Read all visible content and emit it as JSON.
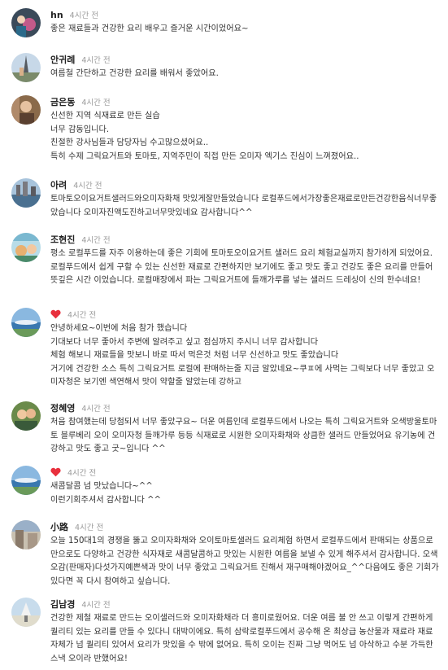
{
  "comments": [
    {
      "name": "hn",
      "time": "4시간 전",
      "lines": [
        "좋은 재료들과 건강한 요리 배우고 즐거운 시간이었어요~"
      ]
    },
    {
      "name": "안귀례",
      "time": "4시간 전",
      "lines": [
        "여름철 간단하고 건강한 요리를 배워서 좋았어요."
      ]
    },
    {
      "name": "금은동",
      "time": "4시간 전",
      "lines": [
        "신선한 지역 식재료로 만든 실습",
        "너무 감동입니다.",
        "친절한 강사님들과 담당자님 수고많으셨어요..",
        "특히 수제 그릭요거트와 토마토, 지역주민이 직접 만든 오미자 엑기스 진심이 느껴졌어요.."
      ]
    },
    {
      "name": "아려",
      "time": "4시간 전",
      "lines": [
        "토마토오이요거트샐러드와오미자화채 맛있게잘만들었습니다 로컬푸드에서가장좋은재료로만든건강한음식너무좋았습니다 오미자진액도진하고너무맛있네요 감사합니다^^"
      ]
    },
    {
      "name": "조현진",
      "time": "4시간 전",
      "lines": [
        "평소 로컬푸드를 자주 이용하는데 좋은 기회에 토마토오이요거트 샐러드 요리 체험교실까지 참가하게 되었어요. 로컬푸드에서 쉽게 구할 수 있는 신선한 재료로 간편하지만 보기에도 좋고 맛도 좋고 건강도 좋은 요리를 만들어 뜻깊은 시간 이었습니다. 로컬매장에서 파는 그릭요거트에 들깨가루를 넣는 샐러드 드레싱이 신의 한수네요!"
      ]
    },
    {
      "name": "",
      "time": "4시간 전",
      "lines": [
        "안녕하세요~이번에 처음 참가 했습니다",
        "기대보다 너무 좋아서 주변에 알려주고 싶고 점심까지 주시니 너무 감사합니다",
        "체험 해보니 재료들을 맛보니 바로 따서 먹은것 처럼 너무 신선하고 맛도 좋았습니다",
        "거기에 건강한 소스 특히 그릭요거트 로컬에 판매하는줄 지금 알았네요~쿠ㅍ에 사먹는 그릭보다 너무 좋았고 오미자청은 보기엔 색연해서 맛이 약할줄 알았는데 강하고"
      ]
    },
    {
      "name": "정혜영",
      "time": "4시간 전",
      "lines": [
        "처음 참여했는데 당첨되서 너무 좋았구요~ 더운 여름인데 로컬푸드에서 나오는 특히 그릭요거트와 오색방울토마토 블루베리 오이 오미자청 들깨가루 등등 식재료로 시원한 오미자화채와 상큼한 샐러드 만들었어요 유기농에 건강하고 맛도 좋고 굿~입니다 ^^"
      ]
    },
    {
      "name": "",
      "time": "4시간 전",
      "lines": [
        "새콤달콤 넘 맛났습니다~^^",
        "이런기회주셔서 감사합니다 ^^"
      ]
    },
    {
      "name": "小路",
      "time": "4시간 전",
      "lines": [
        "오늘 150대1의 경쟁을 뚫고 오미자화채와 오이토마토샐러드 요리체험 하면서 로컬푸드에서 판매되는 상품으로만으로도 다양하고 건강한 식자재로 새콤달콤하고 맛있는 시원한 여름을 보낼 수 있게 해주셔서 감사합니다. 오색오감(판매자)다섯가지예쁜색과 맛이 너무 좋았고 그릭요거트 진해서 재구매해야겠어요_^^다음에도 좋은 기회가 있다면 꼭 다시 참여하고 싶습니다."
      ]
    },
    {
      "name": "김남경",
      "time": "4시간 전",
      "lines": [
        "건강한 제철 재료로 만드는 오이샐러드와 오미자화채라 더 흥미로웠어요. 더운 여름 불 안 쓰고 이렇게 간편하게 퀄리티 있는 요리를 만들 수 있다니 대박이에요. 특히 삼락로컬푸드에서 공수해 온 최상급 농산물과 재료라 재료 자체가 넘 퀄리티 있어서 요리가 맛있을 수 밖에 없어요. 특히 오이는 진짜 그냥 먹어도 넘 아삭하고 수분 가득한 스낵 오이라 반했어요!"
      ]
    }
  ],
  "colors": {
    "heart": "#e8303d",
    "time": "#9a9a9a",
    "text": "#333333"
  },
  "icons": {
    "heart": "heart-icon"
  }
}
